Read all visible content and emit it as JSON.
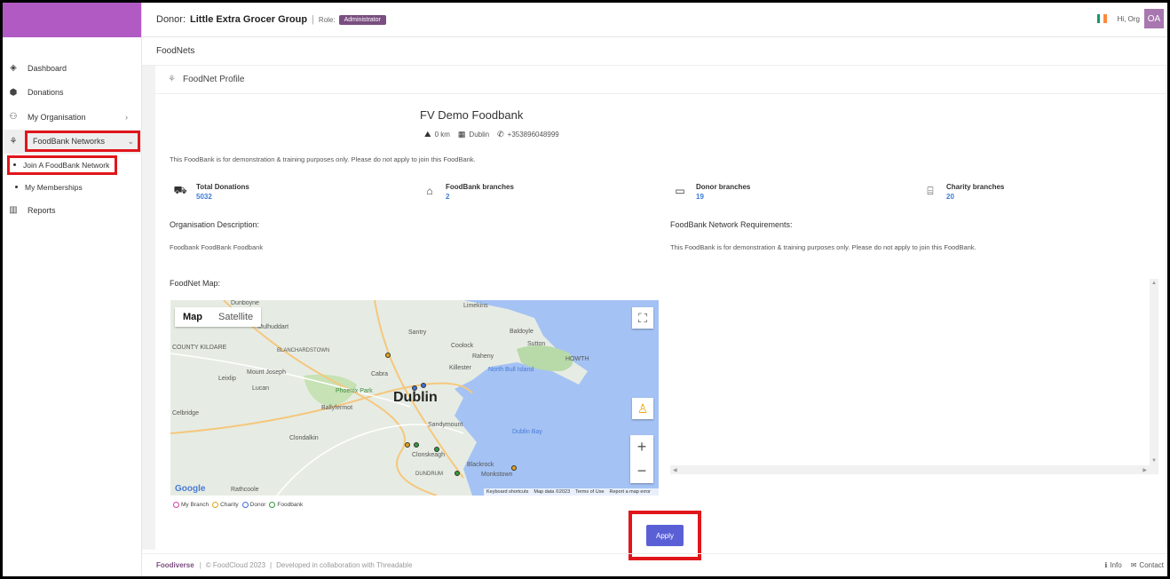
{
  "header": {
    "donor_label": "Donor:",
    "donor_name": "Little Extra Grocer Group",
    "separator": "|",
    "role_label": "Role:",
    "role": "Administrator",
    "greeting": "Hi, Org",
    "avatar_initials": "OA",
    "brand_color": "#b25ac4"
  },
  "subheader": {
    "title": "FoodNets"
  },
  "sidebar": {
    "items": [
      {
        "label": "Dashboard",
        "icon": "layers-icon"
      },
      {
        "label": "Donations",
        "icon": "box-icon"
      },
      {
        "label": "My Organisation",
        "icon": "org-chart-icon"
      },
      {
        "label": "FoodBank Networks",
        "icon": "network-icon"
      },
      {
        "label": "Reports",
        "icon": "bar-chart-icon"
      }
    ],
    "sub_items": [
      {
        "label": "Join A FoodBank Network"
      },
      {
        "label": "My Memberships"
      }
    ]
  },
  "profile": {
    "heading": "FoodNet Profile",
    "name": "FV Demo Foodbank",
    "distance": "0 km",
    "city": "Dublin",
    "phone": "+353896048999",
    "notice": "This FoodBank is for demonstration & training purposes only. Please do not apply to join this FoodBank.",
    "stats": [
      {
        "label": "Total Donations",
        "value": "5032"
      },
      {
        "label": "FoodBank branches",
        "value": "2"
      },
      {
        "label": "Donor branches",
        "value": "19"
      },
      {
        "label": "Charity branches",
        "value": "20"
      }
    ],
    "org_desc_label": "Organisation Description:",
    "org_desc": "Foodbank FoodBank Foodbank",
    "requirements_label": "FoodBank Network Requirements:",
    "requirements": "This FoodBank is for demonstration & training purposes only. Please do not apply to join this FoodBank.",
    "map_label": "FoodNet Map:"
  },
  "map": {
    "tab_map": "Map",
    "tab_satellite": "Satellite",
    "city": "Dublin",
    "places": [
      "Dunboyne",
      "Mulhuddart",
      "Santry",
      "Coolock",
      "Baldoyle",
      "Sutton",
      "Raheny",
      "HOWTH",
      "BLANCHARDSTOWN",
      "Killester",
      "North Bull Island",
      "Mount Joseph",
      "Cabra",
      "COUNTY KILDARE",
      "Leixlip",
      "Lucan",
      "Phoenix Park",
      "Celbridge",
      "Ballyfermot",
      "Clondalkin",
      "Sandymount",
      "Dublin Bay",
      "Clonskeagh",
      "Blackrock",
      "Monkstown",
      "Rathcoole",
      "DUNDRUM",
      "Limekins"
    ],
    "footer_items": [
      "Keyboard shortcuts",
      "Map data ©2023",
      "Terms of Use",
      "Report a map error"
    ],
    "google": "Google"
  },
  "legend": [
    {
      "label": "My Branch",
      "color": "#d63fa3"
    },
    {
      "label": "Charity",
      "color": "#e0a21a"
    },
    {
      "label": "Donor",
      "color": "#3d6fd6"
    },
    {
      "label": "Foodbank",
      "color": "#2e9b3a"
    }
  ],
  "apply_label": "Apply",
  "footer": {
    "brand": "Foodiverse",
    "copyright": "© FoodCloud 2023",
    "collab": "Developed in collaboration with Threadable",
    "info": "Info",
    "contact": "Contact"
  }
}
